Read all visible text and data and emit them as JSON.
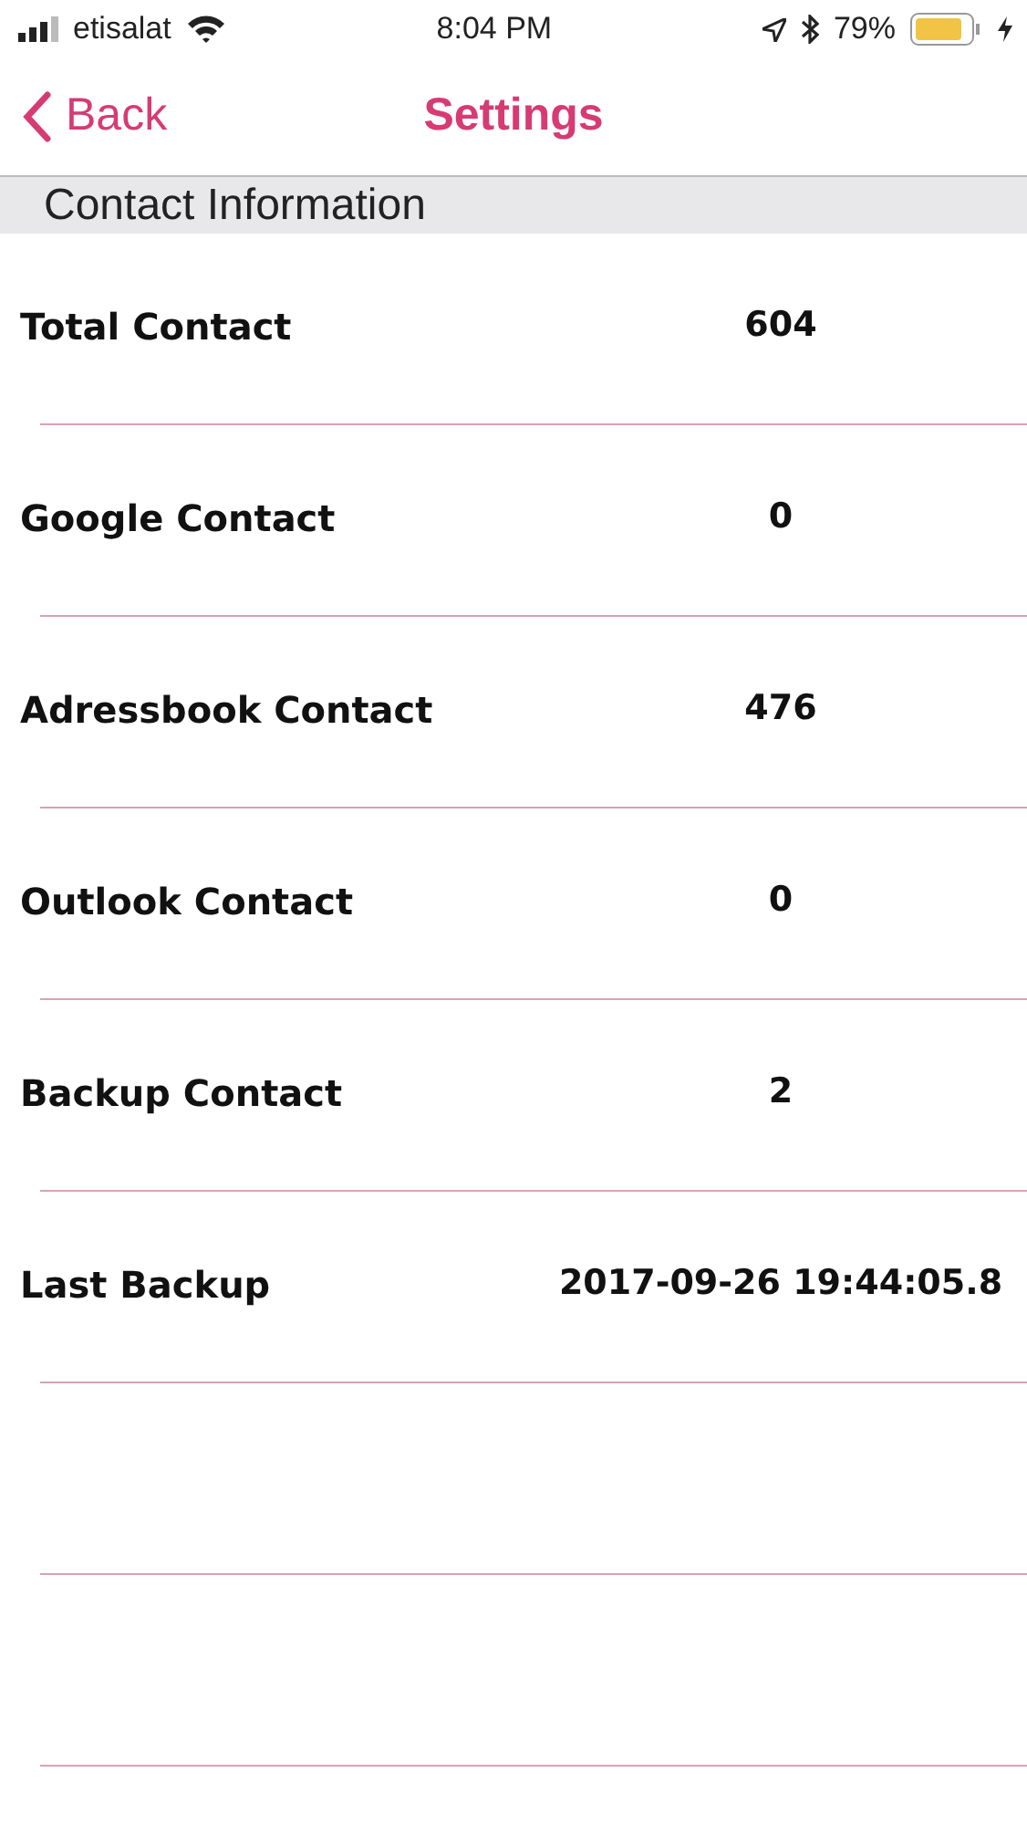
{
  "status_bar": {
    "carrier": "etisalat",
    "time": "8:04 PM",
    "battery": "79%"
  },
  "nav": {
    "back": "Back",
    "title": "Settings"
  },
  "section": {
    "title": "Contact Information"
  },
  "rows": [
    {
      "label": "Total Contact",
      "value": "604"
    },
    {
      "label": "Google Contact",
      "value": "0"
    },
    {
      "label": "Adressbook Contact",
      "value": "476"
    },
    {
      "label": "Outlook Contact",
      "value": "0"
    },
    {
      "label": "Backup Contact",
      "value": "2"
    },
    {
      "label": "Last Backup",
      "value": "2017-09-26 19:44:05.8"
    }
  ]
}
